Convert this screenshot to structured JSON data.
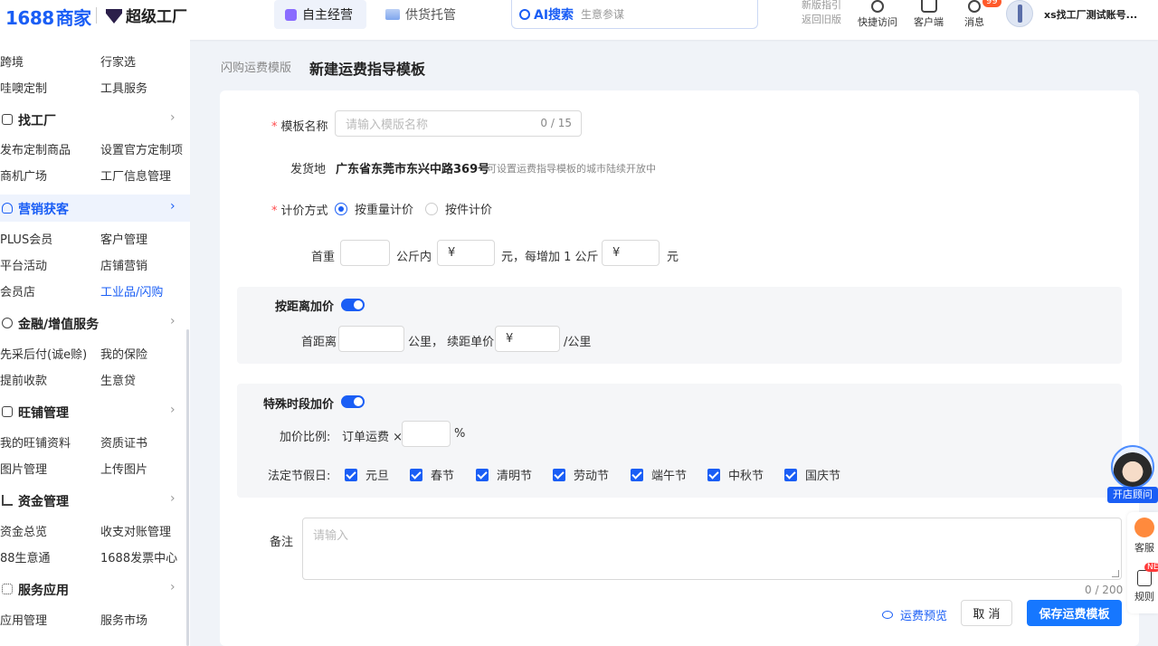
{
  "colors": {
    "accent": "#1a5ef5",
    "save_button": "#1677ff",
    "required": "#ff4d4f"
  },
  "topbar": {
    "logo_num": "1688",
    "logo_merchant": "商家",
    "factory_brand": "超级工厂",
    "tab_self": "自主经营",
    "tab_supply": "供货托管",
    "ai_search": "AI搜索",
    "search_placeholder": "生意参谋",
    "guide_line1": "新版指引",
    "guide_line2": "返回旧版",
    "quick_access": "快捷访问",
    "client": "客户端",
    "messages": "消息",
    "message_badge": "99",
    "account": "xs找工厂测试账号..."
  },
  "sidebar": {
    "rows": [
      {
        "c1": "跨境",
        "c2": "行家选"
      },
      {
        "c1": "哇噢定制",
        "c2": "工具服务"
      }
    ],
    "sections": [
      {
        "title": "找工厂",
        "icon": "shield-icon",
        "items": [
          [
            "发布定制商品",
            "设置官方定制项"
          ],
          [
            "商机广场",
            "工厂信息管理"
          ]
        ]
      },
      {
        "title": "营销获客",
        "icon": "user-icon",
        "items": [
          [
            "PLUS会员",
            "客户管理"
          ],
          [
            "平台活动",
            "店铺营销"
          ],
          [
            "会员店",
            "工业品/闪购"
          ]
        ]
      },
      {
        "title": "金融/增值服务",
        "icon": "heart-shield-icon",
        "items": [
          [
            "先采后付(诚e赊)",
            "我的保险"
          ],
          [
            "提前收款",
            "生意贷"
          ]
        ]
      },
      {
        "title": "旺铺管理",
        "icon": "store-icon",
        "items": [
          [
            "我的旺铺资料",
            "资质证书"
          ],
          [
            "图片管理",
            "上传图片"
          ]
        ]
      },
      {
        "title": "资金管理",
        "icon": "bar-chart-icon",
        "items": [
          [
            "资金总览",
            "收支对账管理"
          ],
          [
            "88生意通",
            "1688发票中心"
          ]
        ]
      },
      {
        "title": "服务应用",
        "icon": "grid-icon",
        "items": [
          [
            "应用管理",
            "服务市场"
          ]
        ]
      }
    ]
  },
  "page": {
    "breadcrumb": "闪购运费模版",
    "title": "新建运费指导模板"
  },
  "form": {
    "name_label": "模板名称",
    "name_placeholder": "请输入模版名称",
    "name_count": "0 / 15",
    "origin_label": "发货地",
    "origin_value": "广东省东莞市东兴中路369号",
    "origin_hint": "可设置运费指导模板的城市陆续开放中",
    "pricing_label": "计价方式",
    "pricing_weight": "按重量计价",
    "pricing_piece": "按件计价",
    "first_weight_label": "首重",
    "kg_within": "公斤内",
    "yuan_symbol": "¥",
    "yuan_each_add": "元，每增加 1 公斤",
    "yuan": "元",
    "distance_toggle": "按距离加价",
    "first_distance": "首距离",
    "km_continue": "公里，  续距单价",
    "per_km": "/公里",
    "special_toggle": "特殊时段加价",
    "markup_label": "加价比例:",
    "order_fee": "订单运费 ×",
    "percent": "%",
    "holidays_label": "法定节假日:",
    "holidays": [
      "元旦",
      "春节",
      "清明节",
      "劳动节",
      "端午节",
      "中秋节",
      "国庆节"
    ],
    "remark_label": "备注",
    "remark_placeholder": "请输入",
    "remark_count": "0 / 200",
    "preview": "运费预览",
    "cancel": "取 消",
    "save": "保存运费模板"
  },
  "float": {
    "consultant": "开店顾问",
    "service": "客服",
    "rules": "规则",
    "new_badge": "NE"
  }
}
